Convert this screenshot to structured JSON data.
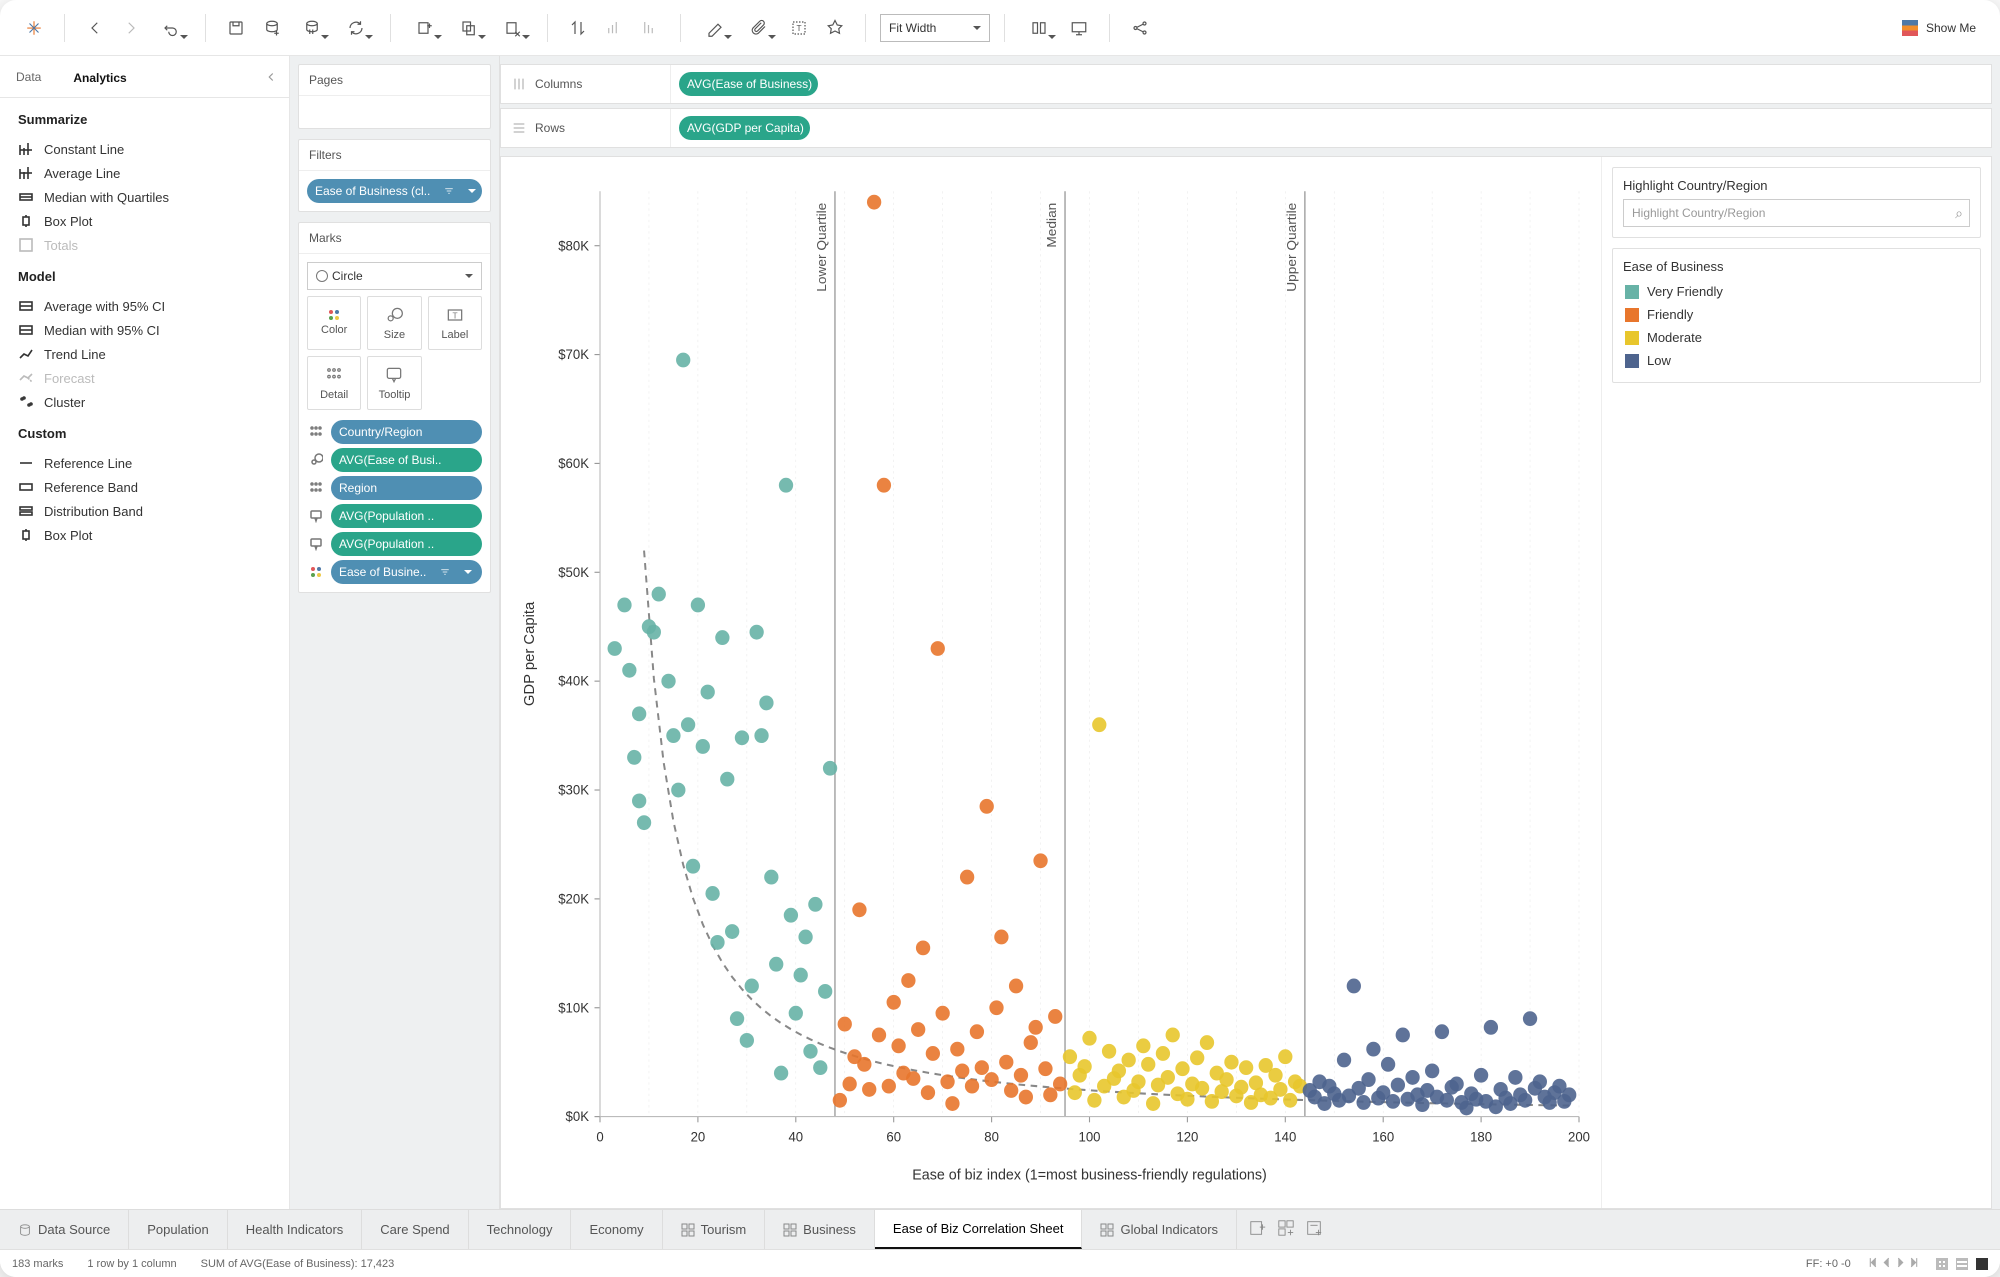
{
  "toolbar": {
    "fit_mode": "Fit Width",
    "showme_label": "Show Me"
  },
  "left_tabs": {
    "data": "Data",
    "analytics": "Analytics"
  },
  "analytics": {
    "sections": {
      "summarize": "Summarize",
      "model": "Model",
      "custom": "Custom"
    },
    "summarize_items": [
      "Constant Line",
      "Average Line",
      "Median with Quartiles",
      "Box Plot",
      "Totals"
    ],
    "model_items": [
      "Average with 95% CI",
      "Median with 95% CI",
      "Trend Line",
      "Forecast",
      "Cluster"
    ],
    "custom_items": [
      "Reference Line",
      "Reference Band",
      "Distribution Band",
      "Box Plot"
    ]
  },
  "shelves": {
    "pages": "Pages",
    "filters": "Filters",
    "filters_pill": "Ease of Business (cl..",
    "marks": "Marks",
    "marks_type": "Circle",
    "marks_buttons": {
      "color": "Color",
      "size": "Size",
      "label": "Label",
      "detail": "Detail",
      "tooltip": "Tooltip"
    },
    "mark_pills": [
      {
        "kind": "detail",
        "label": "Country/Region",
        "color": "blue"
      },
      {
        "kind": "size",
        "label": "AVG(Ease of Busi..",
        "color": "green"
      },
      {
        "kind": "detail",
        "label": "Region",
        "color": "blue"
      },
      {
        "kind": "tooltip",
        "label": "AVG(Population ..",
        "color": "green"
      },
      {
        "kind": "tooltip",
        "label": "AVG(Population ..",
        "color": "green"
      },
      {
        "kind": "color",
        "label": "Ease of Busine..",
        "color": "blue"
      }
    ]
  },
  "rowscols": {
    "columns_label": "Columns",
    "columns_pill": "AVG(Ease of Business)",
    "rows_label": "Rows",
    "rows_pill": "AVG(GDP per Capita)"
  },
  "highlight": {
    "title": "Highlight Country/Region",
    "placeholder": "Highlight Country/Region"
  },
  "legend": {
    "title": "Ease of Business",
    "items": [
      {
        "label": "Very Friendly",
        "color": "#67b2a6"
      },
      {
        "label": "Friendly",
        "color": "#e8762c"
      },
      {
        "label": "Moderate",
        "color": "#e8c62c"
      },
      {
        "label": "Low",
        "color": "#4e648e"
      }
    ]
  },
  "sheet_tabs": {
    "datasource": "Data Source",
    "items": [
      "Population",
      "Health Indicators",
      "Care Spend",
      "Technology",
      "Economy",
      "Tourism",
      "Business",
      "Ease of Biz Correlation Sheet",
      "Global Indicators"
    ],
    "active": "Ease of Biz Correlation Sheet",
    "dashboard_indices": [
      5,
      6,
      8
    ]
  },
  "status": {
    "marks": "183 marks",
    "dims": "1 row by 1 column",
    "sum": "SUM of AVG(Ease of Business): 17,423",
    "ff": "FF: +0 -0"
  },
  "chart_data": {
    "type": "scatter",
    "xlabel": "Ease of biz index (1=most business-friendly regulations)",
    "ylabel": "GDP per Capita",
    "xlim": [
      0,
      200
    ],
    "ylim": [
      0,
      85000
    ],
    "x_ticks": [
      0,
      20,
      40,
      60,
      80,
      100,
      120,
      140,
      160,
      180,
      200
    ],
    "y_ticks": [
      0,
      10000,
      20000,
      30000,
      40000,
      50000,
      60000,
      70000,
      80000
    ],
    "y_tick_labels": [
      "$0K",
      "$10K",
      "$20K",
      "$30K",
      "$40K",
      "$50K",
      "$60K",
      "$70K",
      "$80K"
    ],
    "reference_lines": [
      {
        "label": "Lower Quartile",
        "x": 48
      },
      {
        "label": "Median",
        "x": 95
      },
      {
        "label": "Upper Quartile",
        "x": 144
      }
    ],
    "trend": {
      "type": "power",
      "x0": 9,
      "y0": 52000,
      "x1": 200,
      "y1": 1000
    },
    "series": [
      {
        "name": "Very Friendly",
        "color": "#67b2a6",
        "points": [
          [
            3,
            43000
          ],
          [
            5,
            47000
          ],
          [
            6,
            41000
          ],
          [
            7,
            33000
          ],
          [
            8,
            37000
          ],
          [
            8,
            29000
          ],
          [
            9,
            27000
          ],
          [
            10,
            45000
          ],
          [
            11,
            44500
          ],
          [
            12,
            48000
          ],
          [
            14,
            40000
          ],
          [
            15,
            35000
          ],
          [
            16,
            30000
          ],
          [
            17,
            69500
          ],
          [
            18,
            36000
          ],
          [
            19,
            23000
          ],
          [
            20,
            47000
          ],
          [
            21,
            34000
          ],
          [
            22,
            39000
          ],
          [
            23,
            20500
          ],
          [
            24,
            16000
          ],
          [
            25,
            44000
          ],
          [
            26,
            31000
          ],
          [
            27,
            17000
          ],
          [
            28,
            9000
          ],
          [
            29,
            34800
          ],
          [
            30,
            7000
          ],
          [
            31,
            12000
          ],
          [
            32,
            44500
          ],
          [
            33,
            35000
          ],
          [
            34,
            38000
          ],
          [
            35,
            22000
          ],
          [
            36,
            14000
          ],
          [
            37,
            4000
          ],
          [
            38,
            58000
          ],
          [
            39,
            18500
          ],
          [
            40,
            9500
          ],
          [
            41,
            13000
          ],
          [
            42,
            16500
          ],
          [
            43,
            6000
          ],
          [
            44,
            19500
          ],
          [
            45,
            4500
          ],
          [
            46,
            11500
          ],
          [
            47,
            32000
          ]
        ]
      },
      {
        "name": "Friendly",
        "color": "#e8762c",
        "points": [
          [
            49,
            1500
          ],
          [
            50,
            8500
          ],
          [
            51,
            3000
          ],
          [
            52,
            5500
          ],
          [
            53,
            19000
          ],
          [
            54,
            4800
          ],
          [
            55,
            2500
          ],
          [
            56,
            84000
          ],
          [
            57,
            7500
          ],
          [
            58,
            58000
          ],
          [
            59,
            2800
          ],
          [
            60,
            10500
          ],
          [
            61,
            6500
          ],
          [
            62,
            4000
          ],
          [
            63,
            12500
          ],
          [
            64,
            3500
          ],
          [
            65,
            8000
          ],
          [
            66,
            15500
          ],
          [
            67,
            2200
          ],
          [
            68,
            5800
          ],
          [
            69,
            43000
          ],
          [
            70,
            9500
          ],
          [
            71,
            3200
          ],
          [
            72,
            1200
          ],
          [
            73,
            6200
          ],
          [
            74,
            4200
          ],
          [
            75,
            22000
          ],
          [
            76,
            2800
          ],
          [
            77,
            7800
          ],
          [
            78,
            4500
          ],
          [
            79,
            28500
          ],
          [
            80,
            3400
          ],
          [
            81,
            10000
          ],
          [
            82,
            16500
          ],
          [
            83,
            5000
          ],
          [
            84,
            2400
          ],
          [
            85,
            12000
          ],
          [
            86,
            3800
          ],
          [
            87,
            1800
          ],
          [
            88,
            6800
          ],
          [
            89,
            8200
          ],
          [
            90,
            23500
          ],
          [
            91,
            4400
          ],
          [
            92,
            2000
          ],
          [
            93,
            9200
          ],
          [
            94,
            3000
          ]
        ]
      },
      {
        "name": "Moderate",
        "color": "#e8c62c",
        "points": [
          [
            96,
            5500
          ],
          [
            97,
            2200
          ],
          [
            98,
            3800
          ],
          [
            99,
            4600
          ],
          [
            100,
            7200
          ],
          [
            101,
            1500
          ],
          [
            102,
            36000
          ],
          [
            103,
            2800
          ],
          [
            104,
            6000
          ],
          [
            105,
            3500
          ],
          [
            106,
            4200
          ],
          [
            107,
            1800
          ],
          [
            108,
            5200
          ],
          [
            109,
            2400
          ],
          [
            110,
            3200
          ],
          [
            111,
            6500
          ],
          [
            112,
            4800
          ],
          [
            113,
            1200
          ],
          [
            114,
            2900
          ],
          [
            115,
            5800
          ],
          [
            116,
            3600
          ],
          [
            117,
            7500
          ],
          [
            118,
            2100
          ],
          [
            119,
            4400
          ],
          [
            120,
            1600
          ],
          [
            121,
            3000
          ],
          [
            122,
            5400
          ],
          [
            123,
            2600
          ],
          [
            124,
            6800
          ],
          [
            125,
            1400
          ],
          [
            126,
            4000
          ],
          [
            127,
            2300
          ],
          [
            128,
            3400
          ],
          [
            129,
            5000
          ],
          [
            130,
            1900
          ],
          [
            131,
            2700
          ],
          [
            132,
            4500
          ],
          [
            133,
            1300
          ],
          [
            134,
            3100
          ],
          [
            135,
            2000
          ],
          [
            136,
            4700
          ],
          [
            137,
            1700
          ],
          [
            138,
            3800
          ],
          [
            139,
            2500
          ],
          [
            140,
            5500
          ],
          [
            141,
            1500
          ],
          [
            142,
            3200
          ],
          [
            143,
            2800
          ]
        ]
      },
      {
        "name": "Low",
        "color": "#4e648e",
        "points": [
          [
            145,
            2400
          ],
          [
            146,
            1800
          ],
          [
            147,
            3200
          ],
          [
            148,
            1200
          ],
          [
            149,
            2800
          ],
          [
            150,
            2100
          ],
          [
            151,
            1500
          ],
          [
            152,
            5200
          ],
          [
            153,
            1900
          ],
          [
            154,
            12000
          ],
          [
            155,
            2600
          ],
          [
            156,
            1300
          ],
          [
            157,
            3400
          ],
          [
            158,
            6200
          ],
          [
            159,
            1700
          ],
          [
            160,
            2200
          ],
          [
            161,
            4800
          ],
          [
            162,
            1400
          ],
          [
            163,
            2900
          ],
          [
            164,
            7500
          ],
          [
            165,
            1600
          ],
          [
            166,
            3600
          ],
          [
            167,
            2000
          ],
          [
            168,
            1100
          ],
          [
            169,
            2400
          ],
          [
            170,
            4200
          ],
          [
            171,
            1800
          ],
          [
            172,
            7800
          ],
          [
            173,
            1500
          ],
          [
            174,
            2700
          ],
          [
            175,
            3000
          ],
          [
            176,
            1300
          ],
          [
            177,
            800
          ],
          [
            178,
            2100
          ],
          [
            179,
            1600
          ],
          [
            180,
            3800
          ],
          [
            181,
            1400
          ],
          [
            182,
            8200
          ],
          [
            183,
            900
          ],
          [
            184,
            2500
          ],
          [
            185,
            1700
          ],
          [
            186,
            1200
          ],
          [
            187,
            3600
          ],
          [
            188,
            2000
          ],
          [
            189,
            1500
          ],
          [
            190,
            9000
          ],
          [
            191,
            2600
          ],
          [
            192,
            3200
          ],
          [
            193,
            1800
          ],
          [
            194,
            1300
          ],
          [
            195,
            2200
          ],
          [
            196,
            2800
          ],
          [
            197,
            1400
          ],
          [
            198,
            2000
          ]
        ]
      }
    ]
  }
}
